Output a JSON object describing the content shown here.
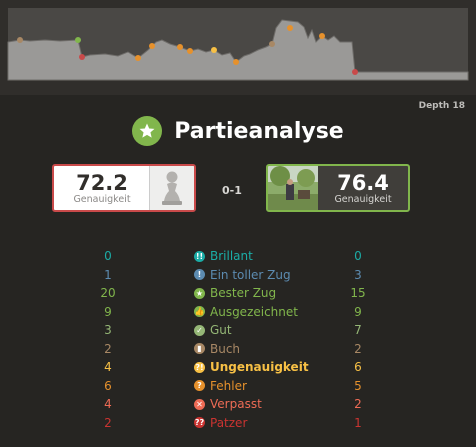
{
  "analysis": {
    "depth_label": "Depth 18",
    "title": "Partieanalyse",
    "result": "0-1"
  },
  "white": {
    "accuracy": "72.2",
    "accuracy_label": "Genauigkeit",
    "border_color": "#c94a4a",
    "avatar": "pawn-icon"
  },
  "black": {
    "accuracy": "76.4",
    "accuracy_label": "Genauigkeit",
    "border_color": "#81b64c",
    "avatar": "player-photo"
  },
  "eval_graph": {
    "white_fill": "#9a9997",
    "black_fill": "#5b5957",
    "note_colors": [
      "#81b64c",
      "#e6912c",
      "#c94a4a",
      "#f7c045",
      "#a88865"
    ]
  },
  "classifications": [
    {
      "label": "Brillant",
      "white": "0",
      "black": "0",
      "color": "#1baca6",
      "icon": "brilliant-icon",
      "glyph": "!!"
    },
    {
      "label": "Ein toller Zug",
      "white": "1",
      "black": "3",
      "color": "#5c8bb0",
      "icon": "great-move-icon",
      "glyph": "!"
    },
    {
      "label": "Bester Zug",
      "white": "20",
      "black": "15",
      "color": "#81b64c",
      "icon": "best-move-icon",
      "glyph": "★"
    },
    {
      "label": "Ausgezeichnet",
      "white": "9",
      "black": "9",
      "color": "#81b64c",
      "icon": "excellent-icon",
      "glyph": "👍"
    },
    {
      "label": "Gut",
      "white": "3",
      "black": "7",
      "color": "#95b776",
      "icon": "good-icon",
      "glyph": "✓"
    },
    {
      "label": "Buch",
      "white": "2",
      "black": "2",
      "color": "#a88865",
      "icon": "book-icon",
      "glyph": "▮"
    },
    {
      "label": "Ungenauigkeit",
      "white": "4",
      "black": "6",
      "color": "#f7c045",
      "icon": "inaccuracy-icon",
      "glyph": "?!"
    },
    {
      "label": "Fehler",
      "white": "6",
      "black": "5",
      "color": "#e6912c",
      "icon": "mistake-icon",
      "glyph": "?"
    },
    {
      "label": "Verpasst",
      "white": "4",
      "black": "2",
      "color": "#ee6b55",
      "icon": "miss-icon",
      "glyph": "✕"
    },
    {
      "label": "Patzer",
      "white": "2",
      "black": "1",
      "color": "#ca3431",
      "icon": "blunder-icon",
      "glyph": "??"
    }
  ]
}
